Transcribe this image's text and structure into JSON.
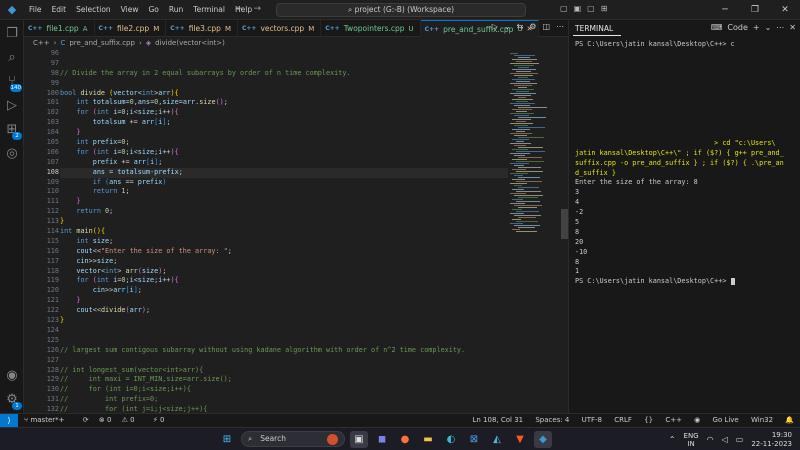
{
  "window": {
    "menu": [
      "File",
      "Edit",
      "Selection",
      "View",
      "Go",
      "Run",
      "Terminal",
      "Help"
    ],
    "command_center": "project (G:-B) (Workspace)"
  },
  "activity_bar": {
    "source_control_badge": "140",
    "extensions_badge": "2",
    "accounts_badge": "1"
  },
  "tabs": [
    {
      "name": "file1.cpp",
      "status": "A",
      "status_color": "#73c991"
    },
    {
      "name": "file2.cpp",
      "status": "M",
      "status_color": "#e2c08d"
    },
    {
      "name": "file3.cpp",
      "status": "M",
      "status_color": "#e2c08d"
    },
    {
      "name": "vectors.cpp",
      "status": "M",
      "status_color": "#e2c08d"
    },
    {
      "name": "Twopointers.cpp",
      "status": "U",
      "status_color": "#73c991"
    },
    {
      "name": "pre_and_suffix.cpp",
      "status": "U",
      "status_color": "#73c991",
      "active": true
    }
  ],
  "breadcrumb": {
    "folder": "C++",
    "file": "pre_and_suffix.cpp",
    "symbol": "divide(vector<int>)"
  },
  "editor": {
    "current_line": 108,
    "lines": [
      {
        "n": "96",
        "t": ""
      },
      {
        "n": "97",
        "t": ""
      },
      {
        "n": "98",
        "t": "<span class=\"cm\">// Divide the array in 2 equal subarrays by order of n time complexity.</span>"
      },
      {
        "n": "99",
        "t": ""
      },
      {
        "n": "100",
        "t": "<span class=\"kw\">bool</span> <span class=\"fn\">divide</span> <span class=\"br1\">(</span><span class=\"vr\">vector</span><span class=\"pl\">&lt;</span><span class=\"kw\">int</span><span class=\"pl\">&gt;</span><span class=\"vr\">arr</span><span class=\"br1\">)</span><span class=\"br1\">{</span>"
      },
      {
        "n": "101",
        "t": "    <span class=\"kw\">int</span> <span class=\"vr\">totalsum</span>=<span class=\"nm\">0</span>,<span class=\"vr\">ans</span>=<span class=\"nm\">0</span>,<span class=\"vr\">size</span>=<span class=\"vr\">arr</span>.<span class=\"fn\">size</span><span class=\"br2\">()</span>;"
      },
      {
        "n": "102",
        "t": "    <span class=\"kw\">for</span> <span class=\"br2\">(</span><span class=\"kw\">int</span> <span class=\"vr\">i</span>=<span class=\"nm\">0</span>;<span class=\"vr\">i</span>&lt;<span class=\"vr\">size</span>;<span class=\"vr\">i</span>++<span class=\"br2\">)</span><span class=\"br2\">{</span>"
      },
      {
        "n": "103",
        "t": "        <span class=\"vr\">totalsum</span> += <span class=\"vr\">arr</span><span class=\"br3\">[</span><span class=\"vr\">i</span><span class=\"br3\">]</span>;"
      },
      {
        "n": "104",
        "t": "    <span class=\"br2\">}</span>"
      },
      {
        "n": "105",
        "t": "    <span class=\"kw\">int</span> <span class=\"vr\">prefix</span>=<span class=\"nm\">0</span>;"
      },
      {
        "n": "106",
        "t": "    <span class=\"kw\">for</span> <span class=\"br2\">(</span><span class=\"kw\">int</span> <span class=\"vr\">i</span>=<span class=\"nm\">0</span>;<span class=\"vr\">i</span>&lt;<span class=\"vr\">size</span>;<span class=\"vr\">i</span>++<span class=\"br2\">)</span><span class=\"br2\">{</span>"
      },
      {
        "n": "107",
        "t": "        <span class=\"vr\">prefix</span> += <span class=\"vr\">arr</span><span class=\"br3\">[</span><span class=\"vr\">i</span><span class=\"br3\">]</span>;"
      },
      {
        "n": "108",
        "t": "        <span class=\"vr\">ans</span> = <span class=\"vr\">totalsum</span>-<span class=\"vr\">prefix</span>;"
      },
      {
        "n": "109",
        "t": "        <span class=\"kw\">if</span> <span class=\"br3\">(</span><span class=\"vr\">ans</span> == <span class=\"vr\">prefix</span><span class=\"br3\">)</span>"
      },
      {
        "n": "110",
        "t": "        <span class=\"kw\">return</span> <span class=\"nm\">1</span>;"
      },
      {
        "n": "111",
        "t": "    <span class=\"br2\">}</span>"
      },
      {
        "n": "112",
        "t": "    <span class=\"kw\">return</span> <span class=\"nm\">0</span>;"
      },
      {
        "n": "113",
        "t": "<span class=\"br1\">}</span>"
      },
      {
        "n": "114",
        "t": "<span class=\"kw\">int</span> <span class=\"fn\">main</span><span class=\"br1\">()</span><span class=\"br1\">{</span>"
      },
      {
        "n": "115",
        "t": "    <span class=\"kw\">int</span> <span class=\"vr\">size</span>;"
      },
      {
        "n": "116",
        "t": "    <span class=\"vr\">cout</span>&lt;&lt;<span class=\"st\">\"Enter the size of the array: \"</span>;"
      },
      {
        "n": "117",
        "t": "    <span class=\"vr\">cin</span>&gt;&gt;<span class=\"vr\">size</span>;"
      },
      {
        "n": "118",
        "t": "    <span class=\"vr\">vector</span>&lt;<span class=\"kw\">int</span>&gt; <span class=\"fn\">arr</span><span class=\"br2\">(</span><span class=\"vr\">size</span><span class=\"br2\">)</span>;"
      },
      {
        "n": "119",
        "t": "    <span class=\"kw\">for</span> <span class=\"br2\">(</span><span class=\"kw\">int</span> <span class=\"vr\">i</span>=<span class=\"nm\">0</span>;<span class=\"vr\">i</span>&lt;<span class=\"vr\">size</span>;<span class=\"vr\">i</span>++<span class=\"br2\">)</span><span class=\"br2\">{</span>"
      },
      {
        "n": "120",
        "t": "        <span class=\"vr\">cin</span>&gt;&gt;<span class=\"vr\">arr</span><span class=\"br3\">[</span><span class=\"vr\">i</span><span class=\"br3\">]</span>;"
      },
      {
        "n": "121",
        "t": "    <span class=\"br2\">}</span>"
      },
      {
        "n": "122",
        "t": "    <span class=\"vr\">cout</span>&lt;&lt;<span class=\"fn\">divide</span><span class=\"br2\">(</span><span class=\"vr\">arr</span><span class=\"br2\">)</span>;"
      },
      {
        "n": "123",
        "t": "<span class=\"br1\">}</span>"
      },
      {
        "n": "124",
        "t": ""
      },
      {
        "n": "125",
        "t": ""
      },
      {
        "n": "126",
        "t": "<span class=\"cm\">// largest sum contigous subarray without using kadane algorithm with order of n^2 time complexity.</span>"
      },
      {
        "n": "127",
        "t": ""
      },
      {
        "n": "128",
        "t": "<span class=\"cm\">// int longest_sum(vector&lt;int&gt;arr){</span>"
      },
      {
        "n": "129",
        "t": "<span class=\"cm\">//     int maxi = INT_MIN,size=arr.size();</span>"
      },
      {
        "n": "130",
        "t": "<span class=\"cm\">//     for (int i=0;i&lt;size;i++){</span>"
      },
      {
        "n": "131",
        "t": "<span class=\"cm\">//         int prefix=0;</span>"
      },
      {
        "n": "132",
        "t": "<span class=\"cm\">//         for (int j=i;j&lt;size;j++){</span>"
      }
    ]
  },
  "panel": {
    "title": "TERMINAL",
    "shell_label": "Code",
    "terminal_lines": [
      "PS C:\\Users\\jatin kansal\\Desktop\\C++> c",
      "",
      "",
      "",
      "",
      "",
      "",
      "",
      "",
      "",
      "                                  > cd \"c:\\Users\\",
      "jatin kansal\\Desktop\\C++\\\" ; if ($?) { g++ pre_and_",
      "suffix.cpp -o pre_and_suffix } ; if ($?) { .\\pre_an",
      "d_suffix }",
      "Enter the size of the array: 8",
      "3",
      "4",
      "-2",
      "5",
      "8",
      "20",
      "-10",
      "8",
      "1",
      "PS C:\\Users\\jatin kansal\\Desktop\\C++> "
    ]
  },
  "statusbar": {
    "branch": "master*+",
    "sync": "⟳",
    "errors": "0",
    "warnings": "0",
    "ports": "0",
    "cursor_pos": "Ln 108, Col 31",
    "spaces": "Spaces: 4",
    "encoding": "UTF-8",
    "eol": "CRLF",
    "language": "C++",
    "golive": "Go Live",
    "platform": "Win32"
  },
  "taskbar": {
    "search_label": "Search",
    "lang_top": "ENG",
    "lang_bottom": "IN",
    "time": "19:30",
    "date": "22-11-2023"
  },
  "colors": {
    "accent": "#0078d4",
    "editor_bg": "#1f1f1f",
    "sidebar_bg": "#181818"
  }
}
